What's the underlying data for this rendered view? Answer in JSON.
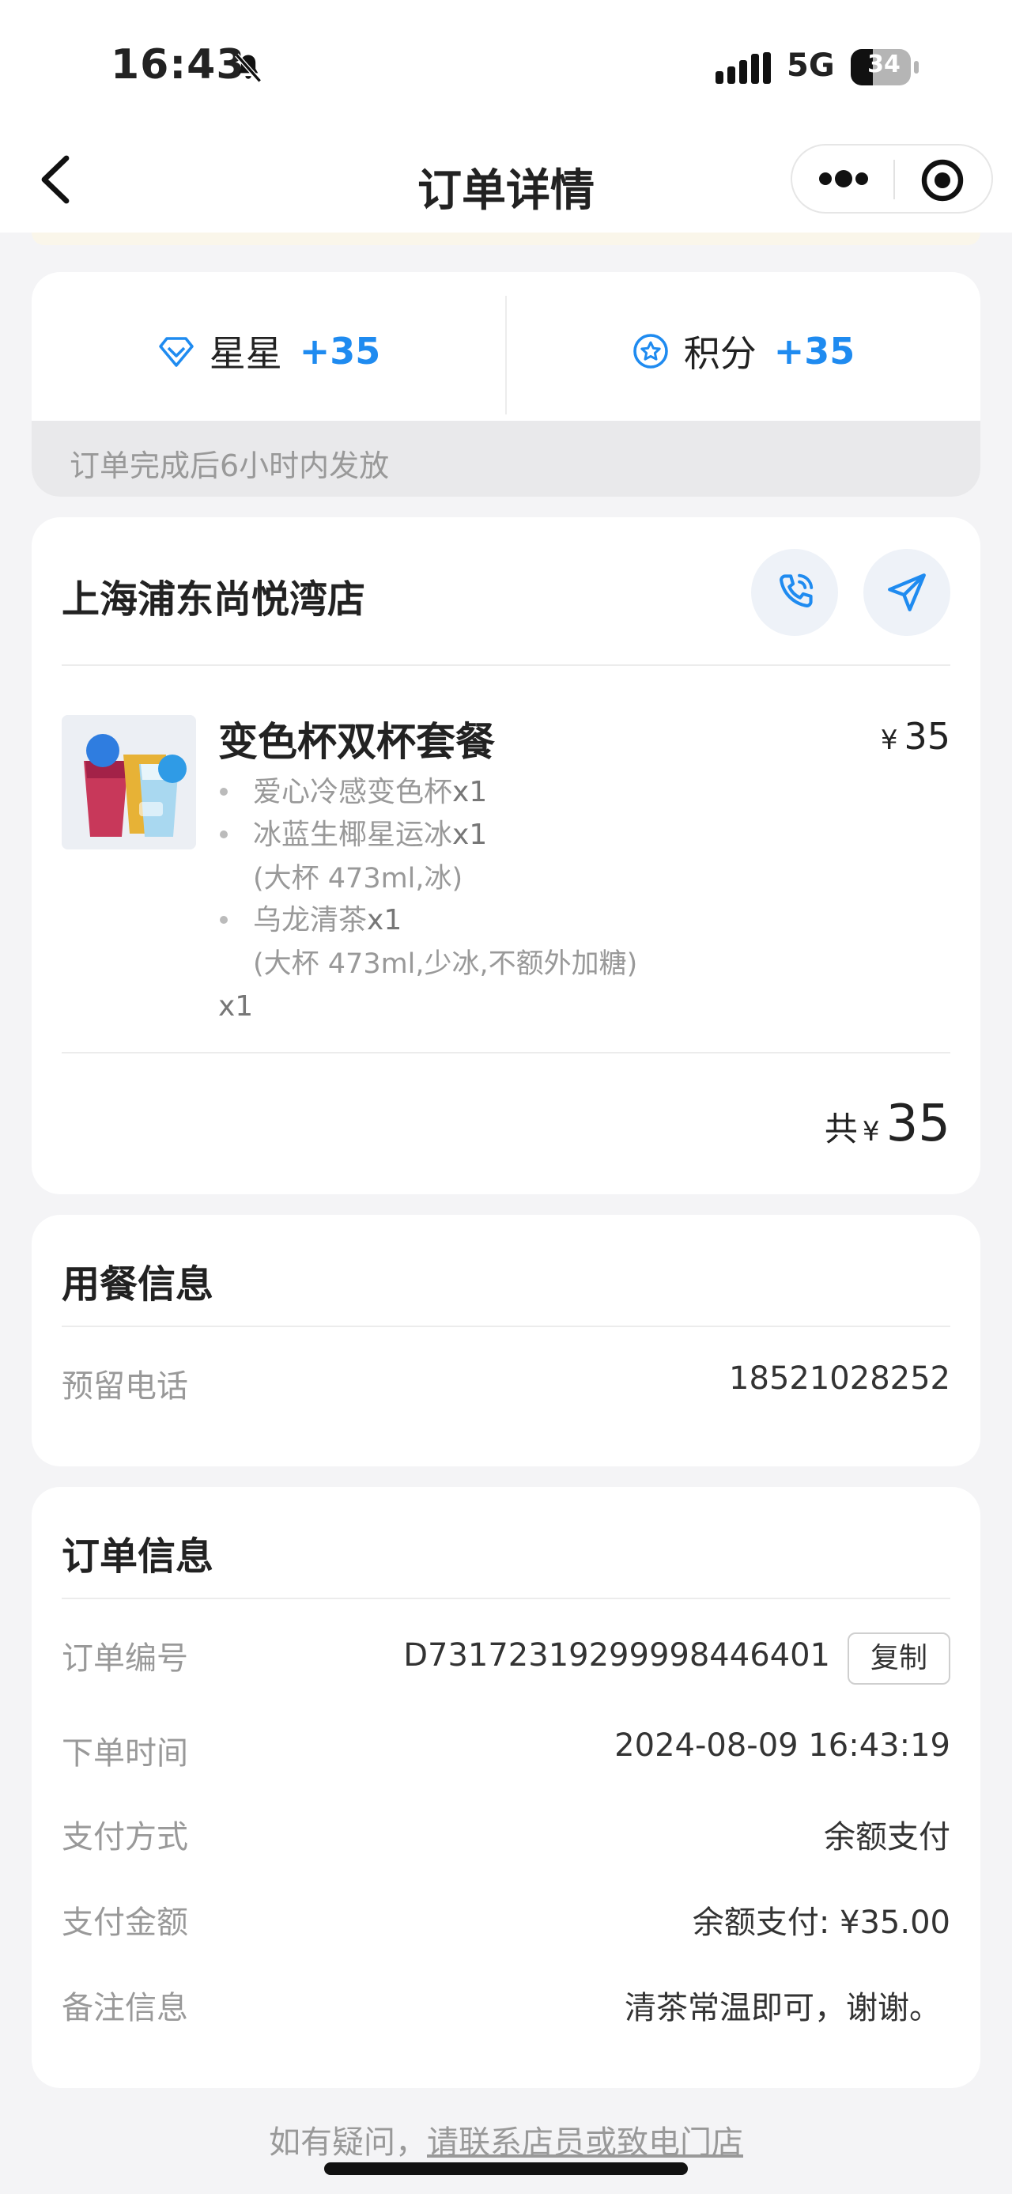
{
  "status_bar": {
    "time": "16:43",
    "network": "5G",
    "battery": "34"
  },
  "nav": {
    "title": "订单详情"
  },
  "rewards": {
    "stars_label": "星星",
    "stars_value": "+35",
    "points_label": "积分",
    "points_value": "+35",
    "note": "订单完成后6小时内发放"
  },
  "store": {
    "name": "上海浦东尚悦湾店",
    "product": {
      "name": "变色杯双杯套餐",
      "price_symbol": "¥",
      "price": "35",
      "items": [
        {
          "name": "爱心冷感变色杯",
          "qty": "x1",
          "spec": ""
        },
        {
          "name": "冰蓝生椰星运冰",
          "qty": "x1",
          "spec": "(大杯 473ml,冰)"
        },
        {
          "name": "乌龙清茶",
          "qty": "x1",
          "spec": "(大杯 473ml,少冰,不额外加糖)"
        }
      ],
      "qty": "x1"
    },
    "total_label": "共",
    "total_symbol": "¥",
    "total": "35"
  },
  "dining": {
    "title": "用餐信息",
    "phone_label": "预留电话",
    "phone_value": "18521028252"
  },
  "order": {
    "title": "订单信息",
    "number_label": "订单编号",
    "number_value": "D7317231929999844640​1",
    "copy_label": "复制",
    "time_label": "下单时间",
    "time_value": "2024-08-09 16:43:19",
    "pay_method_label": "支付方式",
    "pay_method_value": "余额支付",
    "pay_amount_label": "支付金额",
    "pay_amount_value": "余额支付: ¥35.00",
    "note_label": "备注信息",
    "note_value": "清茶常温即可，谢谢。"
  },
  "footer": {
    "prefix": "如有疑问，",
    "link": "请联系店员或致电门店"
  },
  "colors": {
    "accent": "#1f8bf0",
    "background": "#f4f4f6"
  }
}
